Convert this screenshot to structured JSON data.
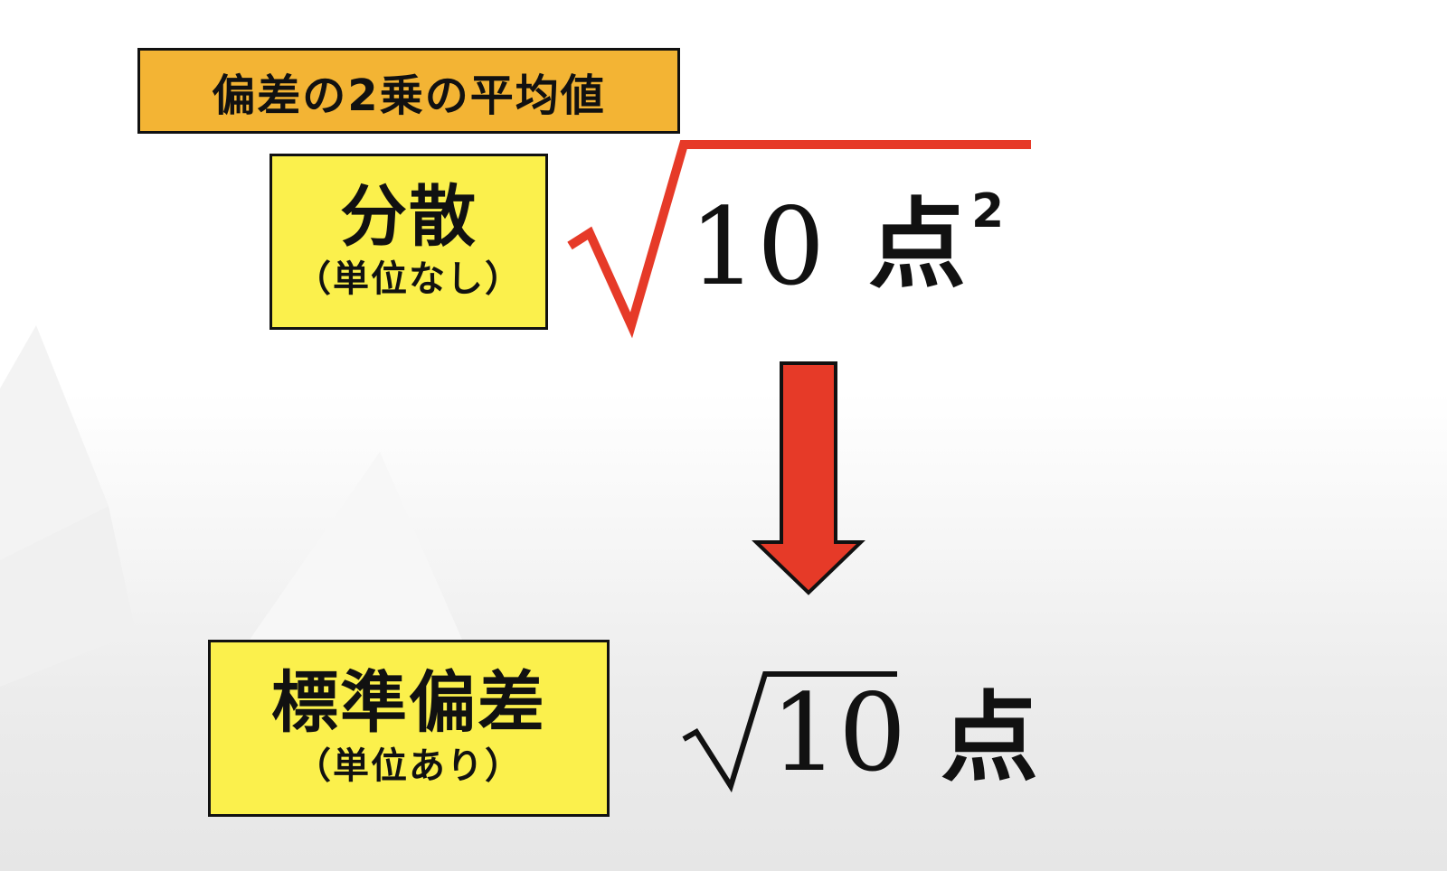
{
  "definition_label": "偏差の2乗の平均値",
  "variance": {
    "term": "分散",
    "note": "（単位なし）",
    "radicand": "10",
    "unit": "点",
    "exponent": "2"
  },
  "standard_deviation": {
    "term": "標準偏差",
    "note": "（単位あり）",
    "radicand": "10",
    "unit": "点"
  },
  "colors": {
    "accent_red": "#e63a28",
    "orange_box": "#f3b434",
    "yellow_box": "#fbf04c"
  }
}
